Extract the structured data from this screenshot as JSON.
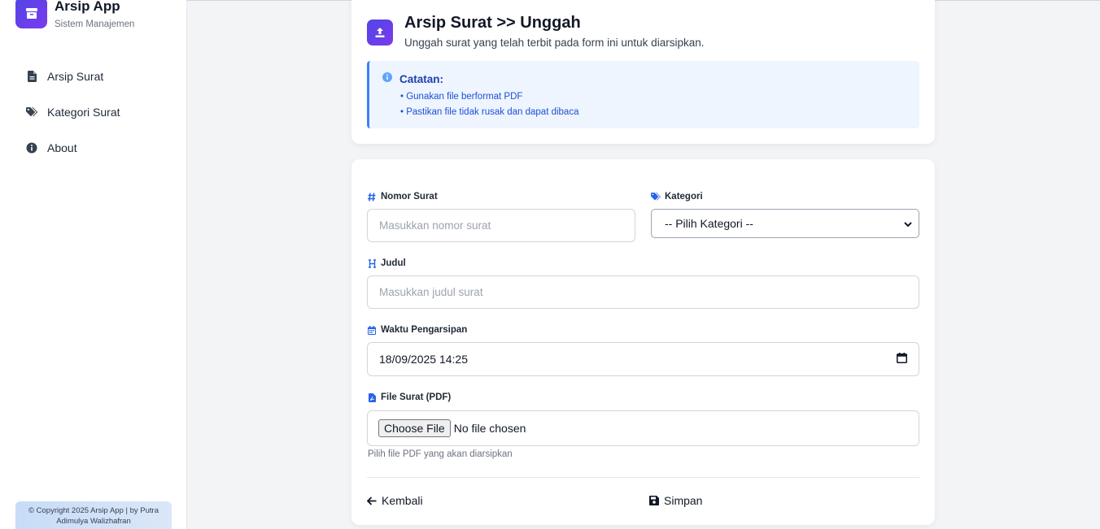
{
  "brand": {
    "title": "Arsip App",
    "subtitle": "Sistem Manajemen"
  },
  "sidebar": {
    "items": [
      {
        "label": "Arsip Surat",
        "icon": "file-icon"
      },
      {
        "label": "Kategori Surat",
        "icon": "tags-icon"
      },
      {
        "label": "About",
        "icon": "info-icon"
      }
    ],
    "footer": "© Copyright 2025 Arsip App | by Putra Adimulya Walizhafran"
  },
  "header": {
    "title": "Arsip Surat >> Unggah",
    "subtitle": "Unggah surat yang telah terbit pada form ini untuk diarsipkan.",
    "note_title": "Catatan:",
    "note_items": [
      "• Gunakan file berformat PDF",
      "• Pastikan file tidak rusak dan dapat dibaca"
    ]
  },
  "form": {
    "nomor_label": "Nomor Surat",
    "nomor_placeholder": "Masukkan nomor surat",
    "kategori_label": "Kategori",
    "kategori_value": "-- Pilih Kategori --",
    "judul_label": "Judul",
    "judul_placeholder": "Masukkan judul surat",
    "waktu_label": "Waktu Pengarsipan",
    "waktu_value": "18/09/2025 14:25",
    "file_label": "File Surat (PDF)",
    "file_button": "Choose File",
    "file_status": "No file chosen",
    "file_help": "Pilih file PDF yang akan diarsipkan",
    "back_label": "Kembali",
    "save_label": "Simpan"
  },
  "colors": {
    "accent": "#4f46e5",
    "accent2": "#7c3aed",
    "info": "#3b82f6",
    "icon_blue": "#2563eb"
  }
}
